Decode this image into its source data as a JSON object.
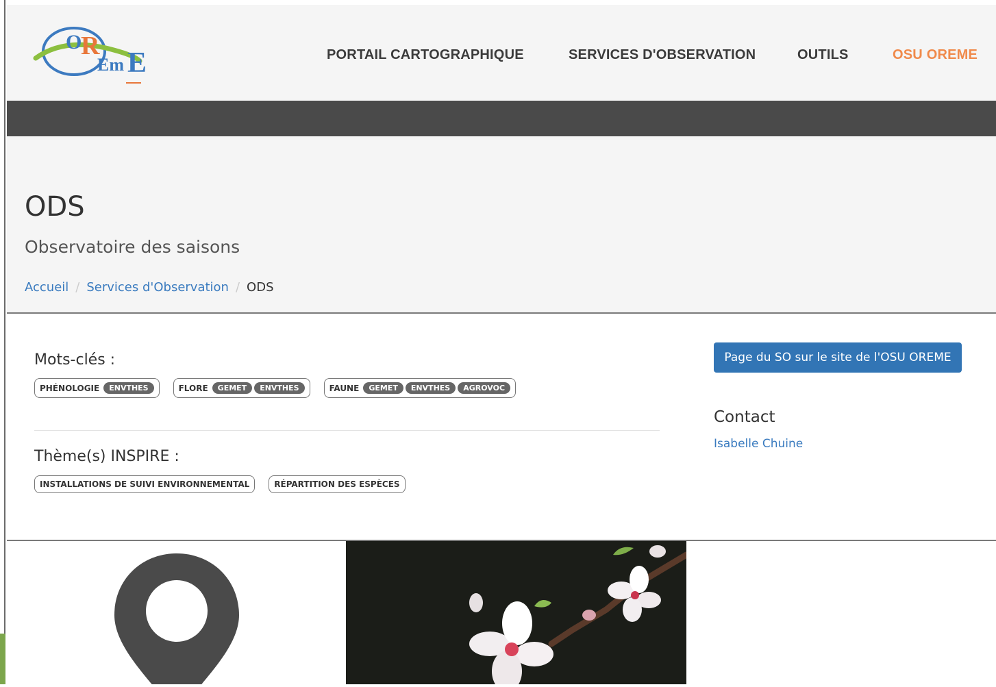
{
  "header": {
    "logo_alt": "OREME logo",
    "logo_text": "OREME",
    "nav": [
      {
        "label": "PORTAIL CARTOGRAPHIQUE",
        "active": false
      },
      {
        "label": "SERVICES D'OBSERVATION",
        "active": false
      },
      {
        "label": "OUTILS",
        "active": false
      },
      {
        "label": "OSU OREME",
        "active": true
      }
    ]
  },
  "page": {
    "title": "ODS",
    "subtitle": "Observatoire des saisons",
    "breadcrumb": [
      {
        "label": "Accueil",
        "link": true
      },
      {
        "label": "Services d'Observation",
        "link": true
      },
      {
        "label": "ODS",
        "link": false
      }
    ]
  },
  "keywords": {
    "label": "Mots-clés :",
    "tags": [
      {
        "keyword": "PHÉNOLOGIE",
        "badges": [
          "ENVTHES"
        ]
      },
      {
        "keyword": "FLORE",
        "badges": [
          "GEMET",
          "ENVTHES"
        ]
      },
      {
        "keyword": "FAUNE",
        "badges": [
          "GEMET",
          "ENVTHES",
          "AGROVOC"
        ]
      }
    ]
  },
  "inspire": {
    "label": "Thème(s) INSPIRE :",
    "tags": [
      "INSTALLATIONS DE SUIVI ENVIRONNEMENTAL",
      "RÉPARTITION DES ESPÈCES"
    ]
  },
  "sidebar": {
    "so_button_label": "Page du SO sur le site de l'OSU OREME",
    "contact_title": "Contact",
    "contact_name": "Isabelle Chuine"
  },
  "colors": {
    "accent_orange": "#f08a4b",
    "link_blue": "#3a7bbf",
    "button_blue": "#3275b5",
    "dark_bar": "#4a4a4a",
    "badge_gray": "#666666"
  },
  "icons": {
    "location": "map-pin-icon"
  }
}
